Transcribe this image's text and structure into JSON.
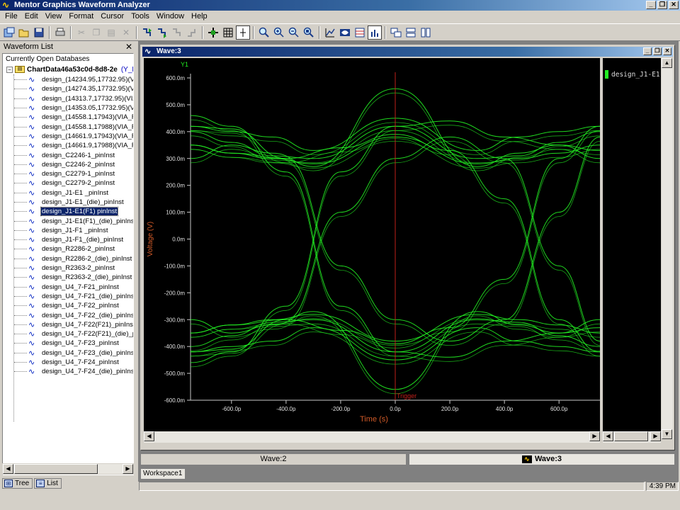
{
  "app": {
    "title": "Mentor Graphics Waveform Analyzer",
    "window_buttons": [
      "_",
      "❐",
      "✕"
    ]
  },
  "menu": [
    "File",
    "Edit",
    "View",
    "Format",
    "Cursor",
    "Tools",
    "Window",
    "Help"
  ],
  "toolbar": {
    "groups": [
      [
        "new-db-icon",
        "open-icon",
        "save-icon"
      ],
      [
        "print-icon"
      ],
      [
        "cut-icon",
        "copy-icon",
        "paste-icon",
        "delete-icon"
      ],
      [
        "add-waveform-icon",
        "add-row-icon",
        "remove-row-icon",
        "overlay-icon"
      ],
      [
        "move-icon",
        "grid-icon",
        "cursor-icon"
      ],
      [
        "zoom-in-icon",
        "zoom-out-icon",
        "zoom-area-icon",
        "zoom-fit-icon"
      ],
      [
        "measure-icon",
        "eye-icon",
        "table-icon",
        "bar-icon"
      ],
      [
        "tile-icon",
        "stack-icon",
        "split-icon"
      ]
    ]
  },
  "waveform_list": {
    "header": "Waveform List",
    "close_glyph": "✕",
    "root_label": "Currently Open Databases",
    "database": {
      "name": "ChartData46a53c0d-8d8-2e",
      "suffix": "(Y_H"
    },
    "items": [
      "design_(14234.95,17732.95)(VI",
      "design_(14274.35,17732.95)(VI",
      "design_(14313.7,17732.95)(VIA",
      "design_(14353.05,17732.95)(VI",
      "design_(14558.1,17943)(VIA_R",
      "design_(14558.1,17988)(VIA_R",
      "design_(14661.9,17943)(VIA_R",
      "design_(14661.9,17988)(VIA_R",
      "design_C2246-1_pinInst",
      "design_C2246-2_pinInst",
      "design_C2279-1_pinInst",
      "design_C2279-2_pinInst",
      "design_J1-E1 _pinInst",
      "design_J1-E1_(die)_pinInst",
      "design_J1-E1(F1) pinInst",
      "design_J1-E1(F1)_(die)_pinInst",
      "design_J1-F1 _pinInst",
      "design_J1-F1_(die)_pinInst",
      "design_R2286-2_pinInst",
      "design_R2286-2_(die)_pinInst",
      "design_R2363-2_pinInst",
      "design_R2363-2_(die)_pinInst",
      "design_U4_7-F21_pinInst",
      "design_U4_7-F21_(die)_pinInst",
      "design_U4_7-F22_pinInst",
      "design_U4_7-F22_(die)_pinInst",
      "design_U4_7-F22(F21)_pinInst",
      "design_U4_7-F22(F21)_(die)_pi",
      "design_U4_7-F23_pinInst",
      "design_U4_7-F23_(die)_pinInst",
      "design_U4_7-F24_pinInst",
      "design_U4_7-F24_(die)_pinInst"
    ],
    "selected_index": 14,
    "tabs": [
      "Tree",
      "List"
    ]
  },
  "wave_window": {
    "title": "Wave:3",
    "legend": "design_J1-E1",
    "trigger_label": "Trigger",
    "colors": {
      "trace": "#22ee22",
      "trigger": "#c0201a",
      "axis_text": "#d05a28",
      "y1": "#22ee22"
    }
  },
  "chart_data": {
    "type": "line",
    "subtype": "eye-diagram",
    "title": "",
    "xlabel": "Time (s)",
    "ylabel": "Voltage (V)",
    "axis_name": "Y1",
    "xlim": [
      -750,
      750
    ],
    "ylim": [
      -600,
      600
    ],
    "x_unit": "p",
    "y_unit": "m",
    "xticks": [
      -600,
      -400,
      -200,
      0,
      200,
      400,
      600
    ],
    "xtick_labels": [
      "-600.0p",
      "-400.0p",
      "-200.0p",
      "0.0p",
      "200.0p",
      "400.0p",
      "600.0p"
    ],
    "yticks": [
      600,
      500,
      400,
      300,
      200,
      100,
      0,
      -100,
      -200,
      -300,
      -400,
      -500,
      -600
    ],
    "ytick_labels": [
      "600.0m",
      "500.0m",
      "400.0m",
      "300.0m",
      "200.0m",
      "100.0m",
      "0.0m",
      "-100.0m",
      "-200.0m",
      "-300.0m",
      "-400.0m",
      "-500.0m",
      "-600.0m"
    ],
    "trigger_x": 0,
    "series": [
      {
        "x": [
          -750,
          -600,
          -450,
          -300,
          0,
          300,
          450,
          600,
          750
        ],
        "values": [
          300,
          350,
          320,
          270,
          560,
          270,
          320,
          350,
          300
        ]
      },
      {
        "x": [
          -750,
          -600,
          -450,
          -300,
          0,
          300,
          450,
          600,
          750
        ],
        "values": [
          420,
          400,
          380,
          330,
          450,
          330,
          380,
          400,
          420
        ]
      },
      {
        "x": [
          -750,
          -600,
          -450,
          -300,
          0,
          300,
          450,
          600,
          750
        ],
        "values": [
          400,
          360,
          310,
          300,
          420,
          300,
          310,
          360,
          400
        ]
      },
      {
        "x": [
          -750,
          -600,
          -450,
          -300,
          0,
          300,
          450,
          600,
          750
        ],
        "values": [
          350,
          320,
          300,
          280,
          380,
          280,
          300,
          320,
          350
        ]
      },
      {
        "x": [
          -750,
          -600,
          -450,
          -300,
          0,
          300,
          450,
          600,
          750
        ],
        "values": [
          -300,
          -350,
          -320,
          -270,
          -560,
          -270,
          -320,
          -350,
          -300
        ]
      },
      {
        "x": [
          -750,
          -600,
          -450,
          -300,
          0,
          300,
          450,
          600,
          750
        ],
        "values": [
          -420,
          -400,
          -380,
          -330,
          -450,
          -330,
          -380,
          -400,
          -420
        ]
      },
      {
        "x": [
          -750,
          -600,
          -450,
          -300,
          0,
          300,
          450,
          600,
          750
        ],
        "values": [
          -400,
          -360,
          -310,
          -300,
          -420,
          -300,
          -310,
          -360,
          -400
        ]
      },
      {
        "x": [
          -750,
          -600,
          -450,
          -300,
          0,
          300,
          450,
          600,
          750
        ],
        "values": [
          -350,
          -320,
          -300,
          -280,
          -380,
          -280,
          -300,
          -320,
          -350
        ]
      },
      {
        "x": [
          -750,
          -600,
          -400,
          -200,
          0,
          200,
          400,
          600,
          750
        ],
        "values": [
          460,
          420,
          250,
          -250,
          -420,
          -440,
          -380,
          -350,
          -330
        ]
      },
      {
        "x": [
          -750,
          -600,
          -400,
          -200,
          0,
          200,
          400,
          600,
          750
        ],
        "values": [
          -460,
          -420,
          -250,
          250,
          420,
          440,
          380,
          350,
          330
        ]
      },
      {
        "x": [
          -750,
          -600,
          -400,
          -200,
          0,
          200,
          400,
          600,
          750
        ],
        "values": [
          350,
          320,
          300,
          340,
          390,
          330,
          150,
          -300,
          -420
        ]
      },
      {
        "x": [
          -750,
          -600,
          -400,
          -200,
          0,
          200,
          400,
          600,
          750
        ],
        "values": [
          -350,
          -320,
          -300,
          -340,
          -390,
          -330,
          -150,
          300,
          420
        ]
      },
      {
        "x": [
          -750,
          -600,
          -400,
          -200,
          0,
          200,
          400,
          600,
          750
        ],
        "values": [
          420,
          410,
          300,
          -100,
          -300,
          -380,
          -300,
          100,
          380
        ]
      },
      {
        "x": [
          -750,
          -600,
          -400,
          -200,
          0,
          200,
          400,
          600,
          750
        ],
        "values": [
          -420,
          -410,
          -300,
          100,
          300,
          380,
          300,
          -100,
          -380
        ]
      }
    ]
  },
  "window_tabs": [
    "Wave:2",
    "Wave:3"
  ],
  "active_window_tab": 1,
  "workspace_tab": "Workspace1",
  "status": {
    "clock": "4:39 PM"
  }
}
